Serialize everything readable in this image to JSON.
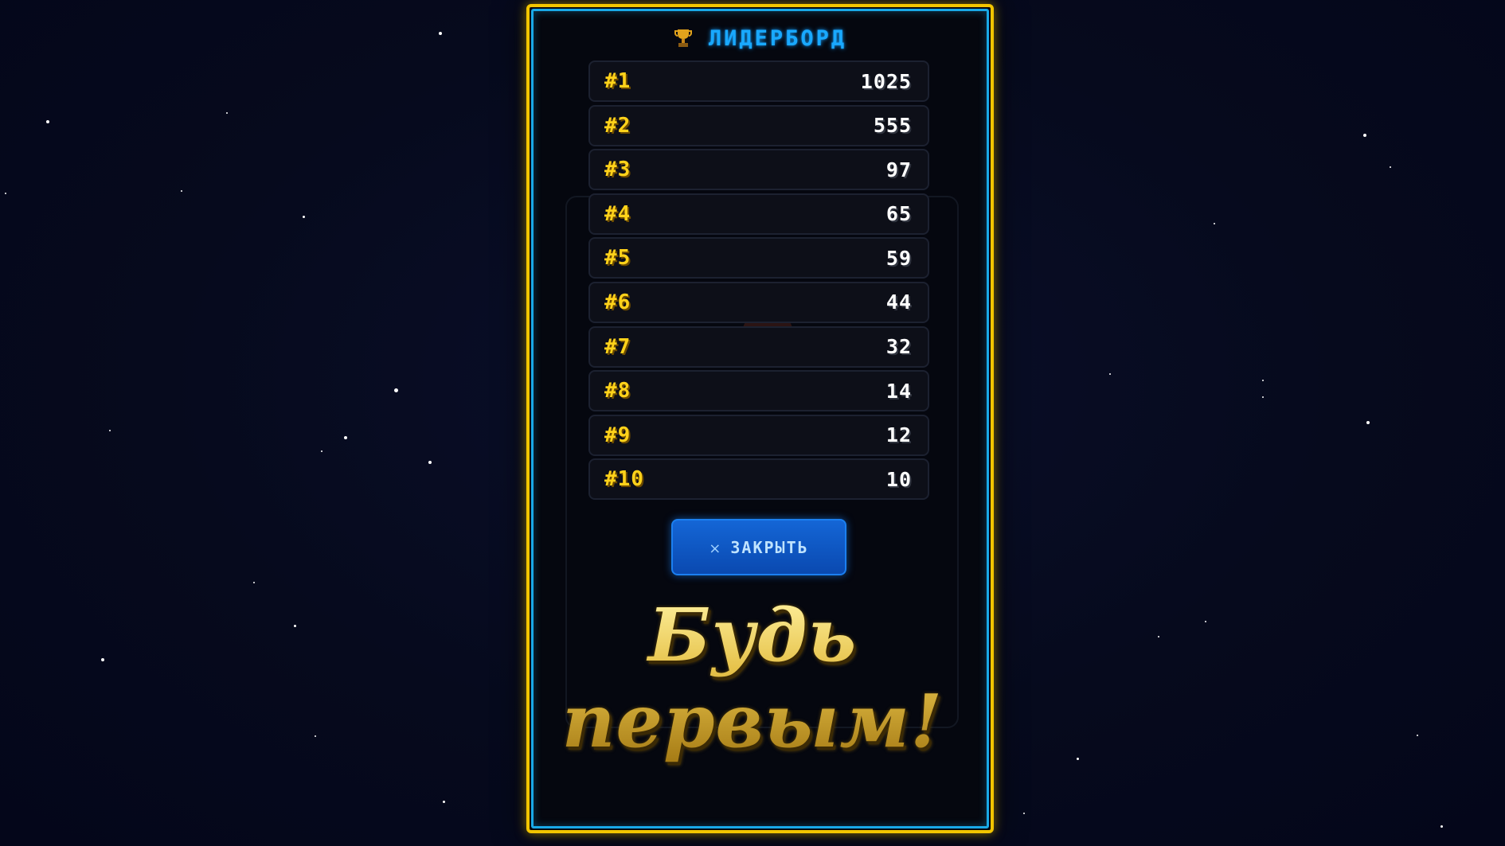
{
  "header": {
    "title": "ЛИДЕРБОРД",
    "icon": "trophy-icon"
  },
  "leaderboard": [
    {
      "rank": "#1",
      "score": "1025"
    },
    {
      "rank": "#2",
      "score": "555"
    },
    {
      "rank": "#3",
      "score": "97"
    },
    {
      "rank": "#4",
      "score": "65"
    },
    {
      "rank": "#5",
      "score": "59"
    },
    {
      "rank": "#6",
      "score": "44"
    },
    {
      "rank": "#7",
      "score": "32"
    },
    {
      "rank": "#8",
      "score": "14"
    },
    {
      "rank": "#9",
      "score": "12"
    },
    {
      "rank": "#10",
      "score": "10"
    }
  ],
  "close_button": {
    "icon": "close-icon",
    "icon_glyph": "×",
    "label": "ЗАКРЫТЬ"
  },
  "caption": "Будь первым!",
  "colors": {
    "frame_outer": "#f2c500",
    "frame_inner": "#19a9e8",
    "title": "#19a9ff",
    "rank": "#ffd21a",
    "score": "#ffffff",
    "button": "#1466d6",
    "caption_gold": "#e6c24a"
  }
}
